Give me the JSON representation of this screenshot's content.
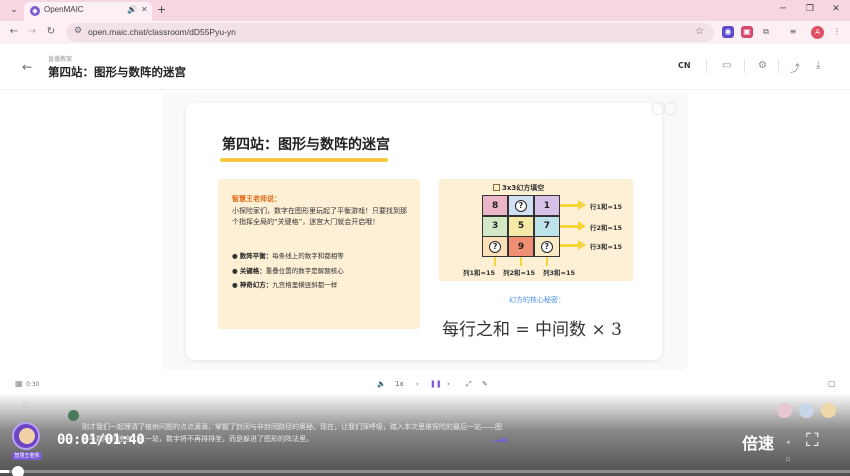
{
  "browser": {
    "tab_title": "OpenMAIC",
    "url": "open.maic.chat/classroom/dD55Pyu-yn",
    "new_tab": "+",
    "profile_initial": "A"
  },
  "header": {
    "breadcrumb": "直播教案",
    "title": "第四站：图形与数阵的迷宫",
    "lang": "CN"
  },
  "slide": {
    "title": "第四站：图形与数阵的迷宫",
    "hint": {
      "heading": "智慧王老师说：",
      "body": "小探险家们，数字在图形里玩起了平衡游戏！只要找到那个指挥全局的“关键格”，迷宫大门就会开启哦！",
      "bullets": [
        {
          "term": "数阵平衡：",
          "text": "每条线上的数字和都相等"
        },
        {
          "term": "关键格：",
          "text": "重叠位置的数字是解题核心"
        },
        {
          "term": "神奇幻方：",
          "text": "九宫格里横竖斜都一样"
        }
      ]
    },
    "grid": {
      "title": "3x3幻方填空",
      "cells": [
        "8",
        "?",
        "1",
        "3",
        "5",
        "7",
        "?",
        "9",
        "?"
      ],
      "cell_colors": [
        "#eab6c8",
        "#cfe1f3",
        "#d6c2e8",
        "#d3e9c6",
        "#f6e9a8",
        "#bfe3ea",
        "#fbe0b8",
        "#ef8f73",
        "#f8ecc4"
      ],
      "row_labels": [
        "行1和=15",
        "行2和=15",
        "行3和=15"
      ],
      "col_labels": [
        "列1和=15",
        "列2和=15",
        "列3和=15"
      ]
    },
    "secret_label": "幻方的核心秘密：",
    "formula": "每行之和 = 中间数 × 3"
  },
  "player": {
    "small_time": "0:30",
    "speed_small": "1x",
    "timecode": "00:01/01:40",
    "speed_label": "倍速",
    "subtitle": "刚才我们一起理清了植树问题的点点滴滴，掌握了封闭与非封闭路径的奥秘。现在，让我们深呼吸，踏入本次思维探险的最后一站——图形与数阵的迷宫。这一站，数字将不再排排坐，而是躲进了图形的阵法里。",
    "teacher_tag": "智慧王老师",
    "progress": 0.01
  }
}
